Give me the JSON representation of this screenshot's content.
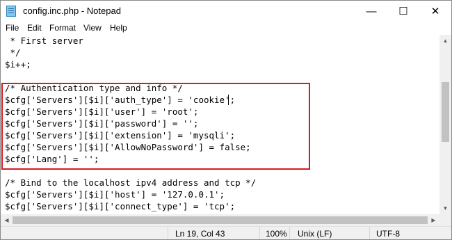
{
  "window": {
    "title": "config.inc.php - Notepad",
    "minimize": "—",
    "maximize": "☐",
    "close": "✕"
  },
  "menu": [
    "File",
    "Edit",
    "Format",
    "View",
    "Help"
  ],
  "code": [
    " * First server",
    " */",
    "$i++;",
    "",
    "/* Authentication type and info */",
    "$cfg['Servers'][$i]['auth_type'] = 'cookie';",
    "$cfg['Servers'][$i]['user'] = 'root';",
    "$cfg['Servers'][$i]['password'] = '';",
    "$cfg['Servers'][$i]['extension'] = 'mysqli';",
    "$cfg['Servers'][$i]['AllowNoPassword'] = false;",
    "$cfg['Lang'] = '';",
    "",
    "/* Bind to the localhost ipv4 address and tcp */",
    "$cfg['Servers'][$i]['host'] = '127.0.0.1';",
    "$cfg['Servers'][$i]['connect_type'] = 'tcp';"
  ],
  "status": {
    "position": "Ln 19, Col 43",
    "zoom": "100%",
    "line_ending": "Unix (LF)",
    "encoding": "UTF-8"
  },
  "colors": {
    "highlight_border": "#d71920",
    "scrollbar": "#f0f0f0"
  },
  "icons": {
    "app": "notepad-icon",
    "scroll_up": "▲",
    "scroll_down": "▼",
    "scroll_left": "◀",
    "scroll_right": "▶"
  }
}
